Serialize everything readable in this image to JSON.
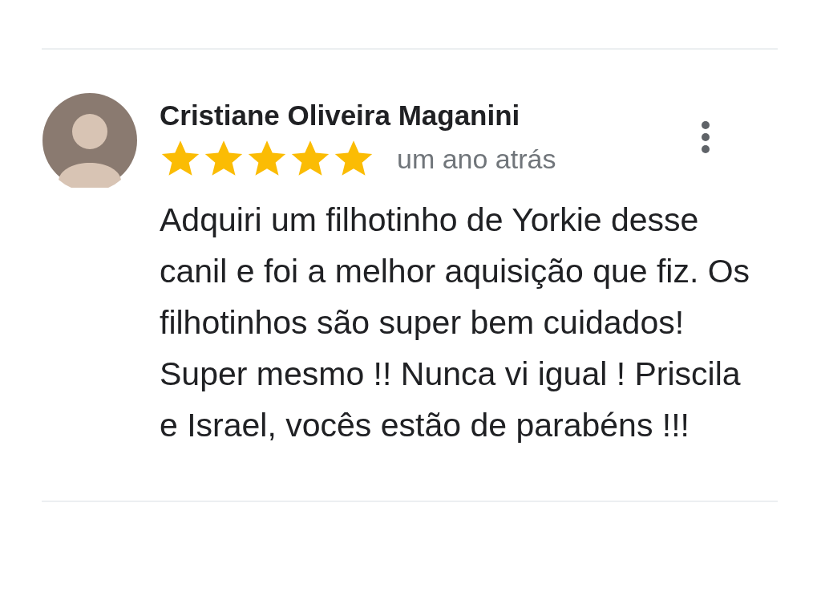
{
  "review": {
    "author": "Cristiane Oliveira Maganini",
    "stars": 5,
    "time": "um ano atrás",
    "text": "Adquiri um filhotinho de Yorkie desse canil e foi a melhor aquisição que fiz. Os filhotinhos são super bem cuidados! Super mesmo !! Nunca vi igual ! Priscila e Israel, vocês estão de parabéns !!!"
  }
}
